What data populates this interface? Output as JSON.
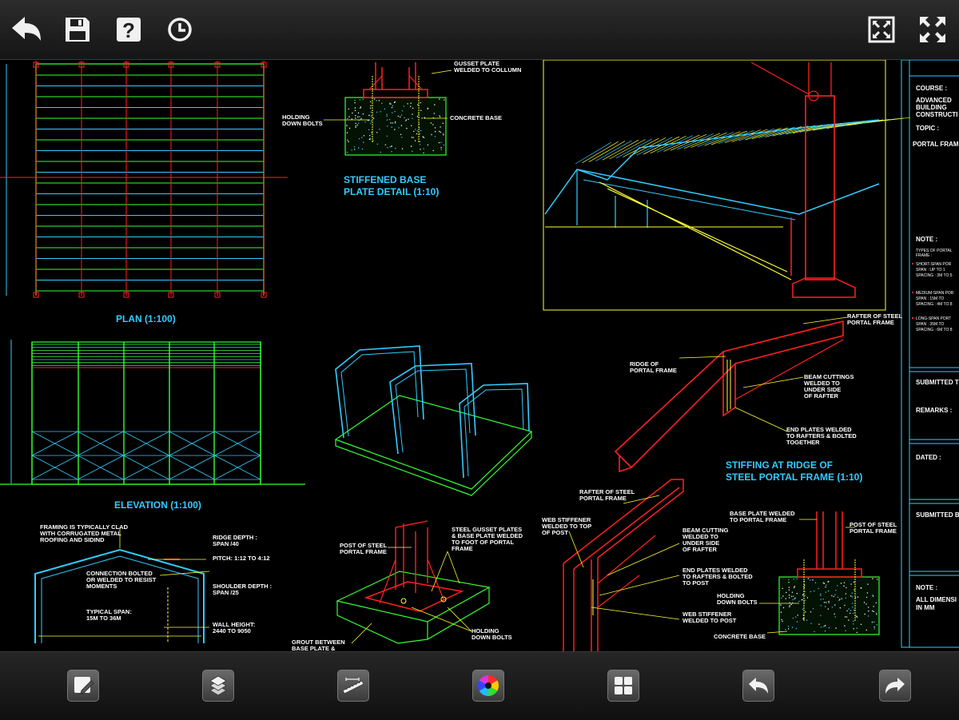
{
  "toolbar": {
    "buttons": [
      {
        "name": "back-button",
        "icon": "back-arrow-icon"
      },
      {
        "name": "save-button",
        "icon": "floppy-disk-icon"
      },
      {
        "name": "help-button",
        "icon": "question-mark-icon"
      },
      {
        "name": "history-button",
        "icon": "clock-icon"
      },
      {
        "name": "zoom-extents-button",
        "icon": "zoom-extents-icon"
      },
      {
        "name": "fullscreen-button",
        "icon": "fullscreen-icon"
      }
    ]
  },
  "drawing": {
    "plan_title": "PLAN (1:100)",
    "elevation_title": "ELEVATION    (1:100)",
    "base_detail_title_1": "STIFFENED BASE",
    "base_detail_title_2": "PLATE DETAIL (1:10)",
    "ridge_title_1": "STIFFING AT RIDGE OF",
    "ridge_title_2": "STEEL PORTAL FRAME (1:10)",
    "labels": {
      "gusset_1": "GUSSET PLATE",
      "gusset_2": "WELDED TO COLLUMN",
      "holding_1": "HOLDING",
      "holding_2": "DOWN BOLTS",
      "concrete_base": "CONCRETE BASE",
      "rafter_1": "RAFTER OF STEEL",
      "rafter_2": "PORTAL FRAME",
      "ridge_of_1": "RIDGE OF",
      "ridge_of_2": "PORTAL FRAME",
      "beam_cut_1": "BEAM CUTTINGS",
      "beam_cut_2": "WELDED TO",
      "beam_cut_3": "UNDER SIDE",
      "beam_cut_4": "OF RAFTER",
      "end_plates_1": "END PLATES WELDED",
      "end_plates_2": "TO RAFTERS & BOLTED",
      "end_plates_3": "TOGETHER",
      "framing_1": "FRAMING IS TYPICALLY CLAD",
      "framing_2": "WITH CORRUGATED METAL",
      "framing_3": "ROOFING AND SIDIND",
      "ridge_depth_1": "RIDGE DEPTH :",
      "ridge_depth_2": "SPAN /40",
      "pitch": "PITCH: 1:12 TO 4:12",
      "connection_1": "CONNECTION BOLTED",
      "connection_2": "OR WELDED TO RESIST",
      "connection_3": "MOMENTS",
      "shoulder_1": "SHOULDER DEPTH :",
      "shoulder_2": "SPAN /25",
      "typical_1": "TYPICAL SPAN:",
      "typical_2": "15M TO 36M",
      "wall_1": "WALL HEIGHT:",
      "wall_2": "2440 TO 9050",
      "post_1": "POST OF STEEL",
      "post_2": "PORTAL FRAME",
      "steel_gusset_1": "STEEL GUSSET PLATES",
      "steel_gusset_2": "& BASE PLATE WELDED",
      "steel_gusset_3": "TO FOOT OF PORTAL",
      "steel_gusset_4": "FRAME",
      "grout_1": "GROUT BETWEEN",
      "grout_2": "BASE PLATE &",
      "web_stiff_1": "WEB STIFFENER",
      "web_stiff_2": "WELDED TO TOP",
      "web_stiff_3": "OF POST",
      "beam_cut2_1": "BEAM CUTTING",
      "beam_cut2_2": "WELDED TO",
      "beam_cut2_3": "UNDER SIDE",
      "beam_cut2_4": "OF RAFTER",
      "end_plates2_1": "END PLATES WELDED",
      "end_plates2_2": "TO RAFTERS & BOLTED",
      "end_plates2_3": "TO POST",
      "holding2_1": "HOLDING",
      "holding2_2": "DOWN BOLTS",
      "web_stiff2_1": "WEB STIFFENER",
      "web_stiff2_2": "WELDED TO POST",
      "concrete_base2": "CONCRETE BASE",
      "base_plate_1": "BASE PLATE WELDED",
      "base_plate_2": "TO PORTAL FRAME",
      "post2_1": "POST OF STEEL",
      "post2_2": "PORTAL FRAME"
    },
    "title_block": {
      "course_label": "COURSE :",
      "course_1": "ADVANCED",
      "course_2": "BUILDING",
      "course_3": "CONSTRUCTI",
      "topic_label": "TOPIC :",
      "topic": "PORTAL FRAM",
      "note_label": "NOTE :",
      "note_types_1": "TYPES OF PORTAL",
      "note_types_2": "FRAME :",
      "short_1": "SHORT-SPAN POR",
      "short_2": "SPAN    : UP TO 1",
      "short_3": "SPACING  : 3M TO 5",
      "medium_1": "MEDIUM-SPAN POR",
      "medium_2": "SPAN     : 15M TO",
      "medium_3": "SPACING  : 4M TO 8",
      "long_1": "LONG-SPAN PORT",
      "long_2": "SPAN     : 35M TO",
      "long_3": "SPACING  : 6M TO 8",
      "submitted_to": "SUBMITTED TO",
      "remarks": "REMARKS :",
      "dated": "DATED :",
      "submitted_by": "SUBMITTED B",
      "note2_label": "NOTE :",
      "note2_1": "ALL DIMENSI",
      "note2_2": "IN MM"
    }
  },
  "bottom_toolbar": {
    "buttons": [
      {
        "name": "markup-button",
        "icon": "edit-pencil-icon"
      },
      {
        "name": "layers-button",
        "icon": "layers-icon"
      },
      {
        "name": "measure-button",
        "icon": "ruler-icon"
      },
      {
        "name": "color-button",
        "icon": "color-wheel-icon"
      },
      {
        "name": "layout-button",
        "icon": "layout-grid-icon"
      },
      {
        "name": "undo-button",
        "icon": "undo-arrow-icon"
      },
      {
        "name": "redo-button",
        "icon": "redo-arrow-icon"
      }
    ]
  },
  "colors": {
    "toolbar_bg": "#1e1e1e",
    "cad_green": "#33ff33",
    "cad_red": "#ff2020",
    "cad_cyan": "#33ccff",
    "cad_yellow": "#ffff33"
  }
}
